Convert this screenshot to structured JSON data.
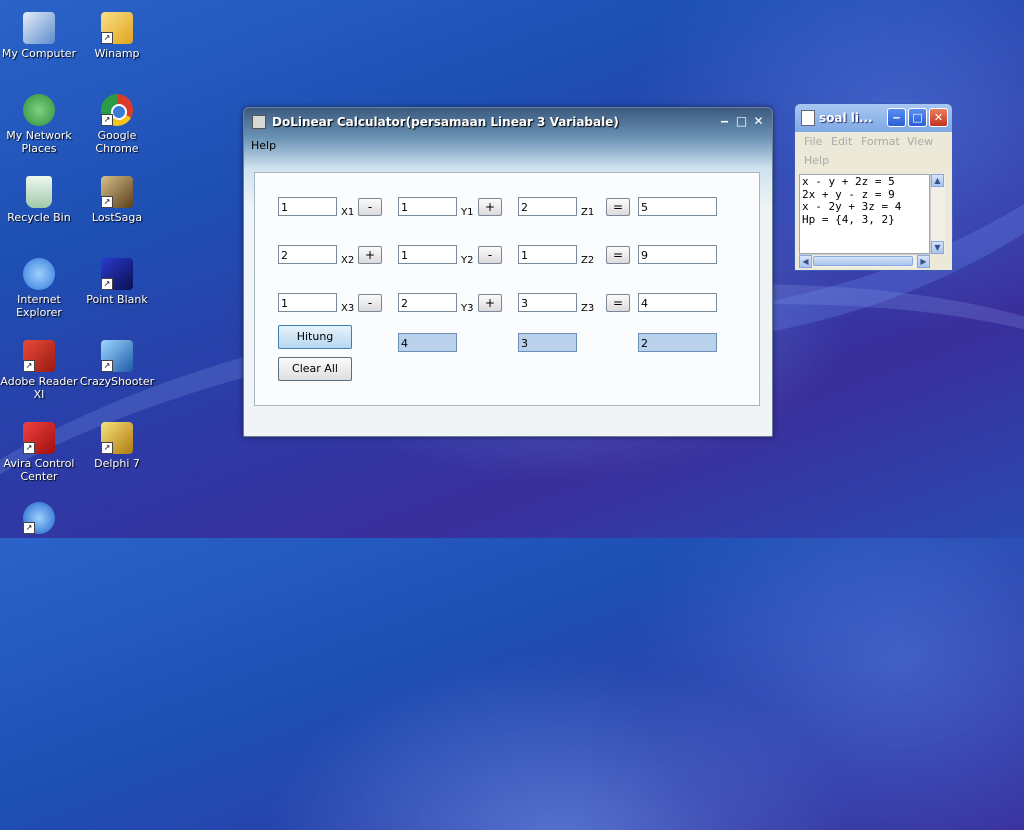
{
  "desktop": {
    "icons": [
      {
        "label": "My Computer",
        "icon": "computer-icon",
        "color": "#5b8ccc"
      },
      {
        "label": "Winamp",
        "icon": "winamp-icon",
        "color": "#e2a21b"
      },
      {
        "label": "My Network Places",
        "icon": "network-icon",
        "color": "#2f8f3c"
      },
      {
        "label": "Google Chrome",
        "icon": "chrome-icon",
        "color": "#dd3b2a"
      },
      {
        "label": "Recycle Bin",
        "icon": "recycle-bin-icon",
        "color": "#cfe6d4"
      },
      {
        "label": "LostSaga",
        "icon": "lostsaga-icon",
        "color": "#8a6a3a"
      },
      {
        "label": "Internet Explorer",
        "icon": "ie-icon",
        "color": "#2f7ad8"
      },
      {
        "label": "Point Blank",
        "icon": "pointblank-icon",
        "color": "#1b2fb0"
      },
      {
        "label": "Adobe Reader XI",
        "icon": "adobe-reader-icon",
        "color": "#c92a1c"
      },
      {
        "label": "CrazyShooter",
        "icon": "crazyshooter-icon",
        "color": "#3f8fd6"
      },
      {
        "label": "Avira Control Center",
        "icon": "avira-icon",
        "color": "#d92020"
      },
      {
        "label": "Delphi 7",
        "icon": "delphi-icon",
        "color": "#e0b020"
      },
      {
        "label": "",
        "icon": "app-icon",
        "color": "#3d8de0"
      }
    ]
  },
  "app": {
    "title": "DoLinear Calculator(persamaan Linear 3 Variabale)",
    "menu": {
      "help": "Help"
    },
    "rows": [
      {
        "x": "1",
        "x_label": "X1",
        "x_sign": "-",
        "y": "1",
        "y_label": "Y1",
        "y_sign": "+",
        "z": "2",
        "z_label": "Z1",
        "eq": "=",
        "result": "5"
      },
      {
        "x": "2",
        "x_label": "X2",
        "x_sign": "+",
        "y": "1",
        "y_label": "Y2",
        "y_sign": "-",
        "z": "1",
        "z_label": "Z2",
        "eq": "=",
        "result": "9"
      },
      {
        "x": "1",
        "x_label": "X3",
        "x_sign": "-",
        "y": "2",
        "y_label": "Y3",
        "y_sign": "+",
        "z": "3",
        "z_label": "Z3",
        "eq": "=",
        "result": "4"
      }
    ],
    "solution": {
      "x": "4",
      "y": "3",
      "z": "2"
    },
    "buttons": {
      "hitung": "Hitung",
      "clear": "Clear All"
    }
  },
  "notepad": {
    "title": "soal li...",
    "menu": {
      "file": "File",
      "edit": "Edit",
      "format": "Format",
      "view": "View",
      "help": "Help"
    },
    "lines": [
      "x - y + 2z = 5",
      "2x + y - z = 9",
      "x - 2y + 3z = 4",
      "Hp = {4, 3, 2}"
    ]
  }
}
